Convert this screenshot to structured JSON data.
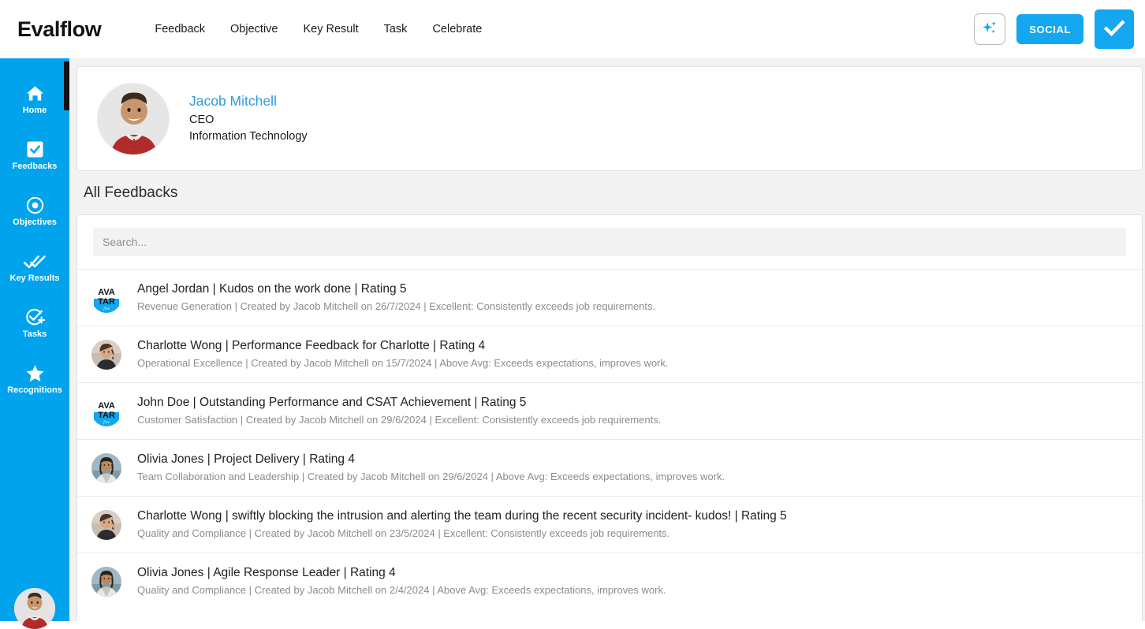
{
  "header": {
    "brand": "Evalflow",
    "nav": [
      {
        "label": "Feedback"
      },
      {
        "label": "Objective"
      },
      {
        "label": "Key Result"
      },
      {
        "label": "Task"
      },
      {
        "label": "Celebrate"
      }
    ],
    "ai_icon": "sparkles-icon",
    "social_label": "SOCIAL",
    "check_icon": "checkmark-icon"
  },
  "sidebar": {
    "accent_color": "#02A3ED",
    "items": [
      {
        "label": "Home",
        "icon": "home-icon"
      },
      {
        "label": "Feedbacks",
        "icon": "checkbox-icon"
      },
      {
        "label": "Objectives",
        "icon": "target-icon"
      },
      {
        "label": "Key Results",
        "icon": "double-check-icon"
      },
      {
        "label": "Tasks",
        "icon": "task-add-icon"
      },
      {
        "label": "Recognitions",
        "icon": "star-icon"
      }
    ],
    "avatar": "user-avatar"
  },
  "profile": {
    "name": "Jacob Mitchell",
    "role": "CEO",
    "department": "Information Technology",
    "name_color": "#2D9CDB",
    "avatar": "profile-photo"
  },
  "main": {
    "section_title": "All Feedbacks",
    "search": {
      "placeholder": "Search...",
      "value": ""
    },
    "feedbacks": [
      {
        "title": "Angel Jordan | Kudos on the work done | Rating 5",
        "subtitle": "Revenue Generation | Created by Jacob Mitchell on 26/7/2024 | Excellent: Consistently exceeds job requirements.",
        "avatar_type": "placeholder"
      },
      {
        "title": "Charlotte Wong | Performance Feedback for Charlotte | Rating 4",
        "subtitle": "Operational Excellence | Created by Jacob Mitchell on 15/7/2024 | Above Avg: Exceeds expectations, improves work.",
        "avatar_type": "photo-a"
      },
      {
        "title": "John Doe | Outstanding Performance and CSAT Achievement | Rating 5",
        "subtitle": "Customer Satisfaction | Created by Jacob Mitchell on 29/6/2024 | Excellent: Consistently exceeds job requirements.",
        "avatar_type": "placeholder"
      },
      {
        "title": "Olivia Jones | Project Delivery | Rating 4",
        "subtitle": "Team Collaboration and Leadership | Created by Jacob Mitchell on 29/6/2024 | Above Avg: Exceeds expectations, improves work.",
        "avatar_type": "photo-b"
      },
      {
        "title": "Charlotte Wong | swiftly blocking the intrusion and alerting the team during the recent security incident- kudos! | Rating 5",
        "subtitle": "Quality and Compliance | Created by Jacob Mitchell on 23/5/2024 | Excellent: Consistently exceeds job requirements.",
        "avatar_type": "photo-a"
      },
      {
        "title": "Olivia Jones | Agile Response Leader | Rating 4",
        "subtitle": "Quality and Compliance | Created by Jacob Mitchell on 2/4/2024 | Above Avg: Exceeds expectations, improves work.",
        "avatar_type": "photo-b"
      }
    ]
  },
  "avatar_placeholder": {
    "line1": "AVA",
    "line2": "TAR",
    "line3": "free"
  }
}
